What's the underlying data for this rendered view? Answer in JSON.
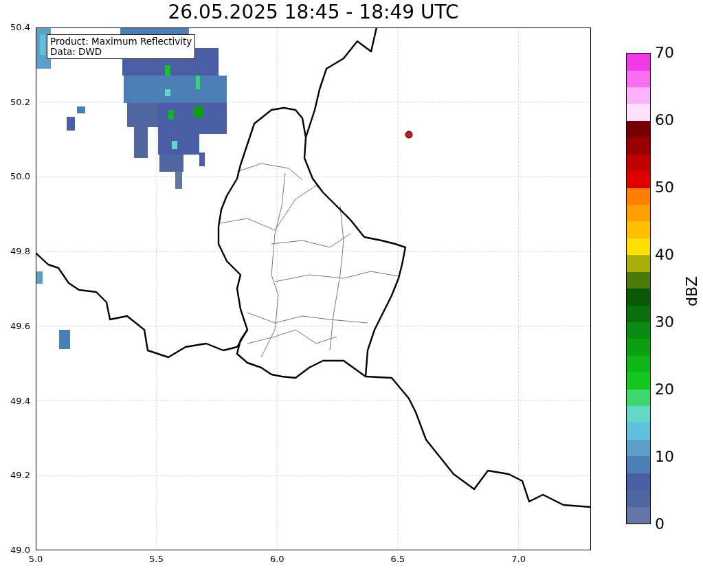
{
  "title": "26.05.2025 18:45 - 18:49 UTC",
  "map": {
    "info_box": [
      "Product: Maximum Reflectivity",
      "Data: DWD"
    ],
    "x_ticks": [
      "5.0",
      "5.5",
      "6.0",
      "6.5",
      "7.0"
    ],
    "y_ticks": [
      "50.4",
      "50.2",
      "50.0",
      "49.8",
      "49.6",
      "49.4",
      "49.2",
      "49.0"
    ]
  },
  "colorbar": {
    "label": "dBZ",
    "ticks": [
      "70",
      "60",
      "50",
      "40",
      "30",
      "20",
      "10",
      "0"
    ],
    "bands": [
      {
        "color": "#6474a4"
      },
      {
        "color": "#5066a0"
      },
      {
        "color": "#4a5ea8"
      },
      {
        "color": "#4a7eb4"
      },
      {
        "color": "#5aa0c8"
      },
      {
        "color": "#5ec0da"
      },
      {
        "color": "#62d8c8"
      },
      {
        "color": "#3ed66e"
      },
      {
        "color": "#14c81e"
      },
      {
        "color": "#10b518"
      },
      {
        "color": "#0aa010"
      },
      {
        "color": "#0a8a10"
      },
      {
        "color": "#0a700f"
      },
      {
        "color": "#0a5a0a"
      },
      {
        "color": "#4a7a0a"
      },
      {
        "color": "#aab00a"
      },
      {
        "color": "#ffdf00"
      },
      {
        "color": "#ffbf00"
      },
      {
        "color": "#ff9f00"
      },
      {
        "color": "#ff7f00"
      },
      {
        "color": "#e00000"
      },
      {
        "color": "#c00000"
      },
      {
        "color": "#990000"
      },
      {
        "color": "#780000"
      },
      {
        "color": "#ffe1ff"
      },
      {
        "color": "#fdb1fb"
      },
      {
        "color": "#f76ff3"
      },
      {
        "color": "#ee3ae8"
      }
    ]
  }
}
